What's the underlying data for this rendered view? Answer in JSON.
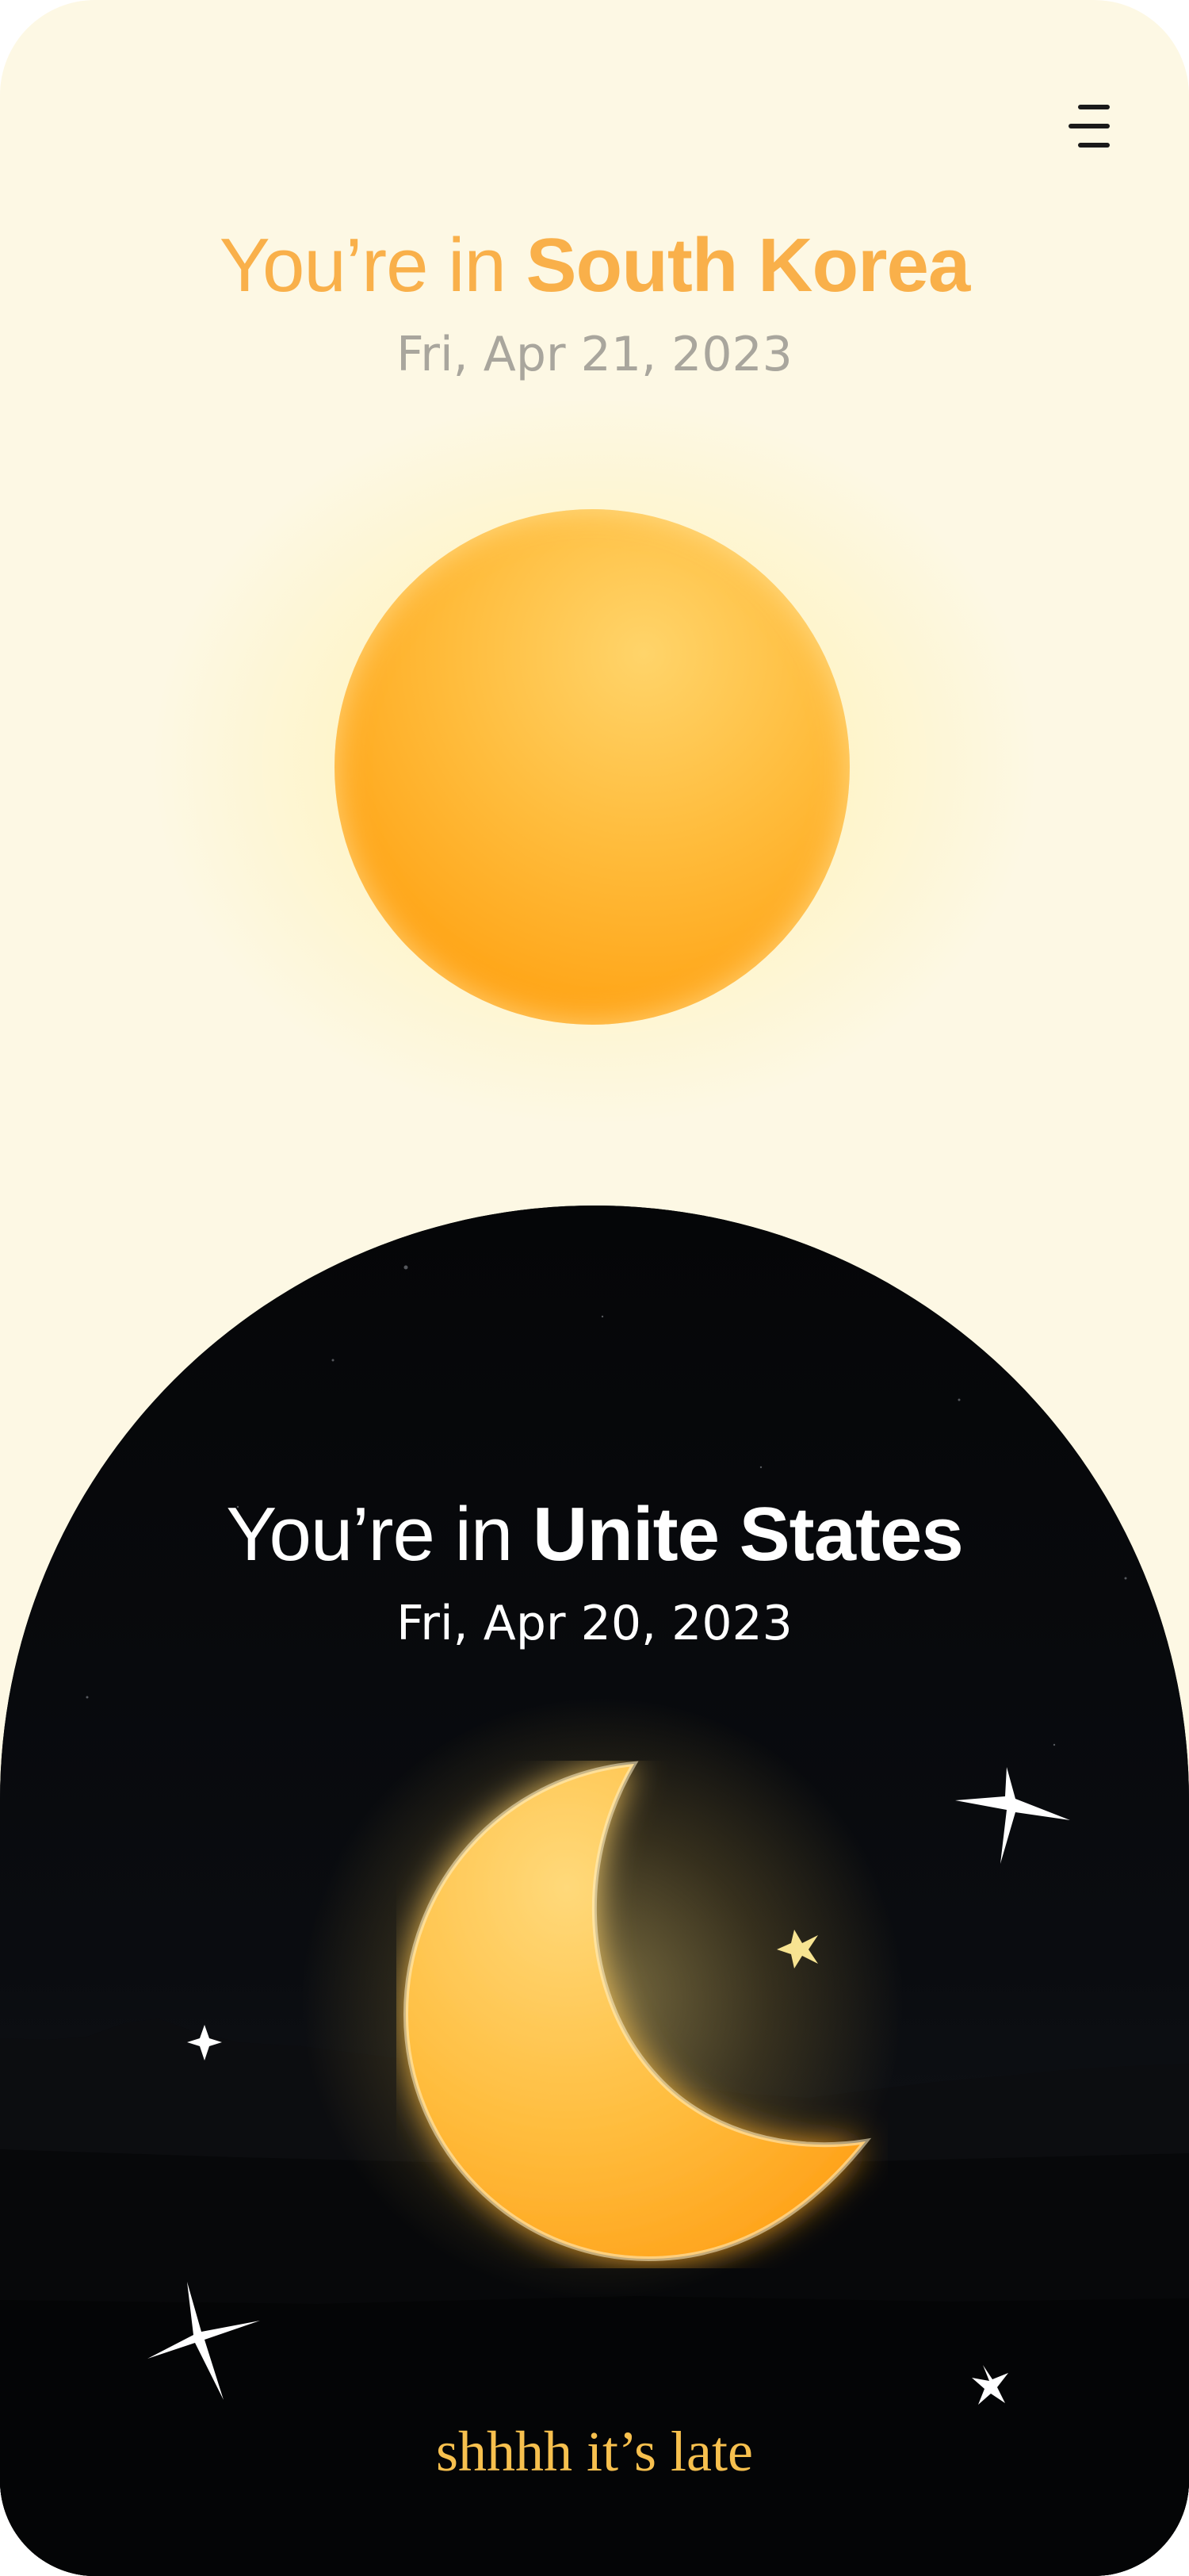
{
  "menu": {
    "icon": "menu-icon"
  },
  "day": {
    "prefix": "You’re in ",
    "country": "South Korea",
    "date": "Fri, Apr 21, 2023",
    "icon": "sun-icon",
    "accent": "#f9b04a"
  },
  "night": {
    "prefix": "You’re in ",
    "country": "Unite States",
    "date": "Fri, Apr 20, 2023",
    "icon": "moon-icon",
    "message": "shhhh it’s late",
    "accent": "#f7c04e",
    "background": "#050608"
  }
}
